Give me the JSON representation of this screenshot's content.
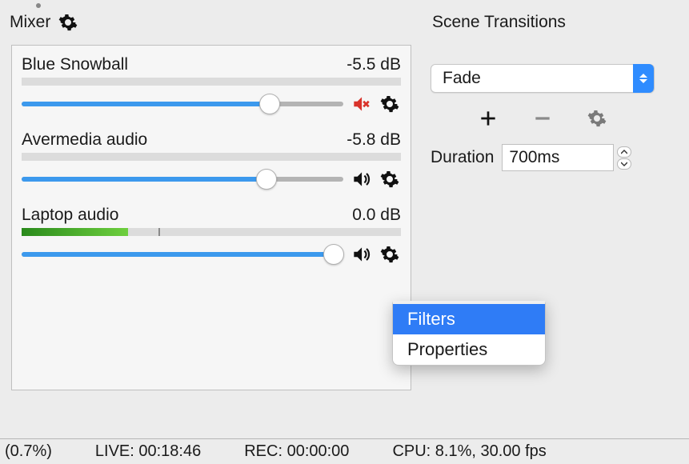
{
  "mixer": {
    "title": "Mixer",
    "sources": [
      {
        "name": "Blue Snowball",
        "db": "-5.5 dB",
        "slider_pct": 77,
        "level_pct": 0,
        "muted": true
      },
      {
        "name": "Avermedia audio",
        "db": "-5.8 dB",
        "slider_pct": 76,
        "level_pct": 0,
        "muted": false
      },
      {
        "name": "Laptop audio",
        "db": "0.0 dB",
        "slider_pct": 97,
        "level_pct": 28,
        "muted": false
      }
    ]
  },
  "transitions": {
    "title": "Scene Transitions",
    "selected": "Fade",
    "duration_label": "Duration",
    "duration_value": "700ms"
  },
  "context_menu": {
    "items": [
      "Filters",
      "Properties"
    ],
    "active_index": 0
  },
  "status": {
    "dropped": "(0.7%)",
    "live": "LIVE: 00:18:46",
    "rec": "REC: 00:00:00",
    "cpu": "CPU: 8.1%, 30.00 fps"
  },
  "icons": {
    "gear": "gear-icon",
    "plus": "plus-icon",
    "minus": "minus-icon",
    "speaker": "speaker-icon",
    "speaker_muted": "speaker-muted-icon"
  }
}
